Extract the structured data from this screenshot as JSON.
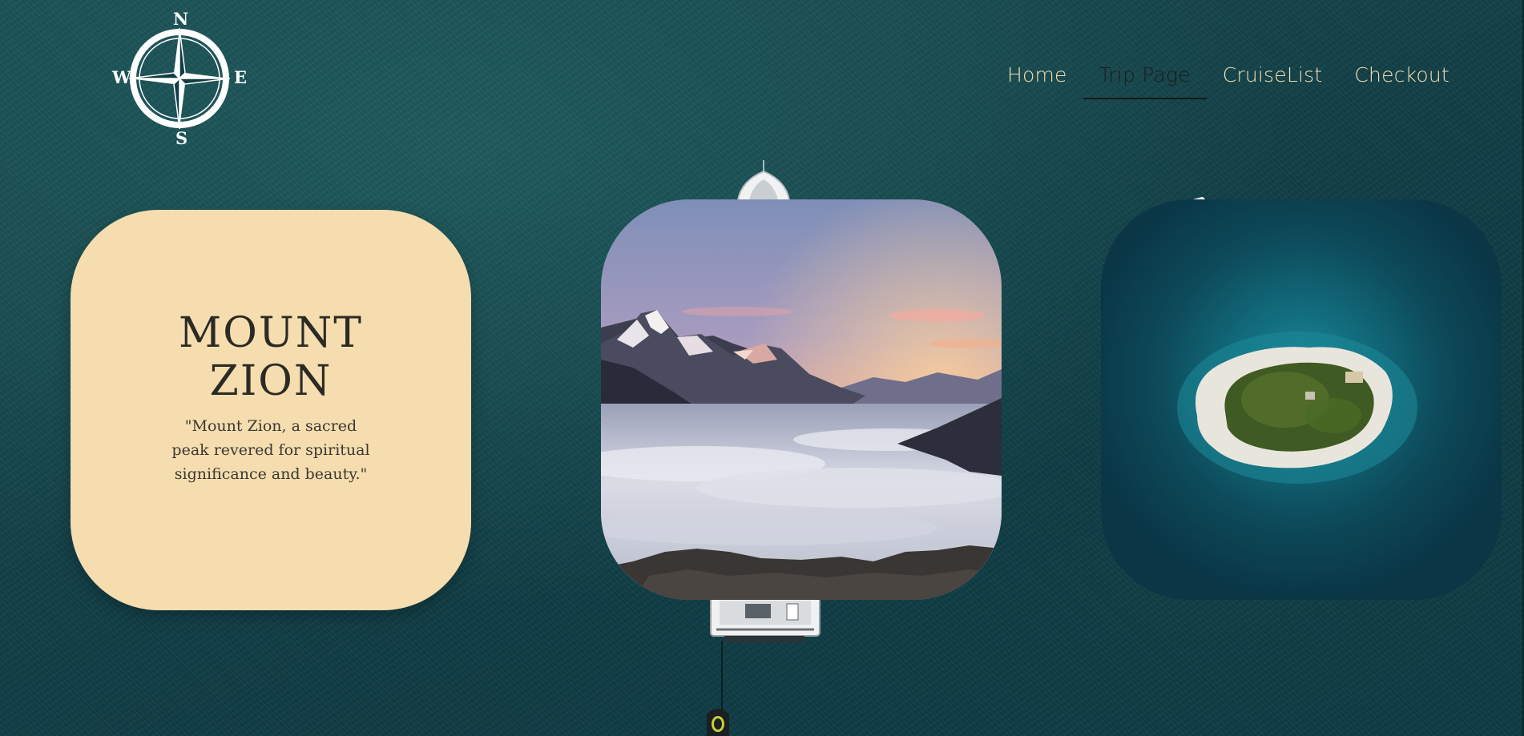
{
  "logo": {
    "icon": "compass-rose-icon",
    "north": "N",
    "south": "S",
    "west": "W",
    "east": "E"
  },
  "nav": {
    "items": [
      {
        "label": "Home",
        "active": false
      },
      {
        "label": "Trip Page",
        "active": true
      },
      {
        "label": "CruiseList",
        "active": false
      },
      {
        "label": "Checkout",
        "active": false
      }
    ]
  },
  "info_card": {
    "title_line1": "MOUNT",
    "title_line2": "ZION",
    "quote": "\"Mount Zion, a sacred peak revered for spiritual significance and beauty.\""
  },
  "images": {
    "mountain": "mountain-sunrise-above-clouds-image",
    "island": "aerial-island-image"
  },
  "colors": {
    "ocean": "#164a50",
    "card_background": "#f5ddb0",
    "nav_text": "#f3dfb3",
    "nav_active": "#1a1d1c"
  }
}
